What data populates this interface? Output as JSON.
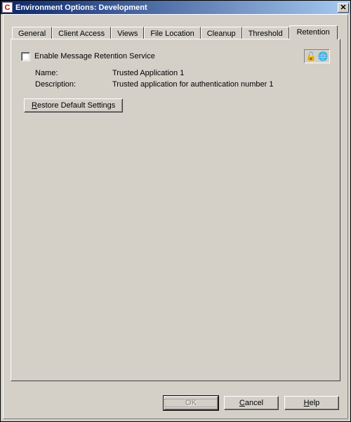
{
  "titlebar": {
    "app_icon_letter": "C",
    "title": "Environment Options:  Development",
    "close_glyph": "✕"
  },
  "tabs": {
    "items": [
      {
        "label": "General"
      },
      {
        "label": "Client Access"
      },
      {
        "label": "Views"
      },
      {
        "label": "File Location"
      },
      {
        "label": "Cleanup"
      },
      {
        "label": "Threshold"
      },
      {
        "label": "Retention"
      }
    ],
    "active_index": 6
  },
  "retention": {
    "enable_label": "Enable Message Retention Service",
    "enable_checked": false,
    "name_label": "Name:",
    "name_value": "Trusted Application 1",
    "desc_label": "Description:",
    "desc_value": "Trusted application for authentication number 1",
    "restore_label_pre": "R",
    "restore_label_rest": "estore Default Settings",
    "lock_glyph": "🔓",
    "globe_glyph": "🌐"
  },
  "buttons": {
    "ok": "OK",
    "cancel_pre": "C",
    "cancel_rest": "ancel",
    "help_pre": "H",
    "help_rest": "elp"
  }
}
